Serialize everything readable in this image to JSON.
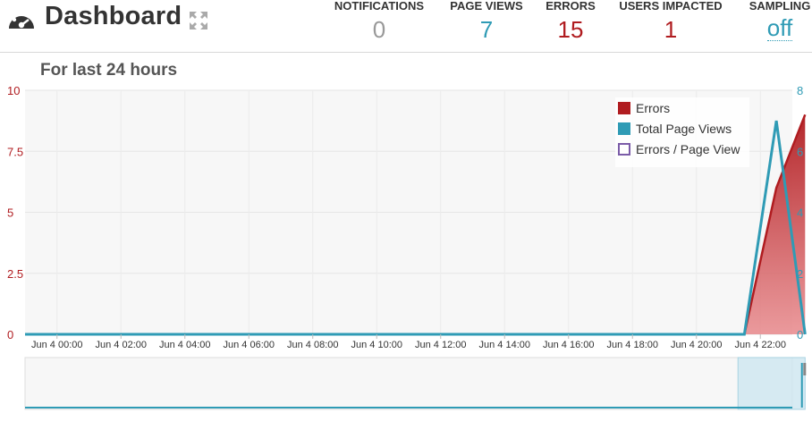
{
  "header": {
    "title": "Dashboard",
    "stats": [
      {
        "label": "NOTIFICATIONS",
        "value": "0",
        "color": "#999999"
      },
      {
        "label": "PAGE VIEWS",
        "value": "7",
        "color": "#2f9bb5"
      },
      {
        "label": "ERRORS",
        "value": "15",
        "color": "#b01c20"
      },
      {
        "label": "USERS IMPACTED",
        "value": "1",
        "color": "#b01c20"
      },
      {
        "label": "SAMPLING",
        "value": "off",
        "color": "#2f9bb5"
      }
    ]
  },
  "section": {
    "title": "For last 24 hours"
  },
  "legend": {
    "errors": "Errors",
    "page_views": "Total Page Views",
    "ratio": "Errors / Page View"
  },
  "chart_data": {
    "type": "area",
    "x_tick_labels": [
      "Jun 4 00:00",
      "Jun 4 02:00",
      "Jun 4 04:00",
      "Jun 4 06:00",
      "Jun 4 08:00",
      "Jun 4 10:00",
      "Jun 4 12:00",
      "Jun 4 14:00",
      "Jun 4 16:00",
      "Jun 4 18:00",
      "Jun 4 20:00",
      "Jun 4 22:00"
    ],
    "x_hours_range": [
      -1,
      23
    ],
    "left_axis": {
      "ticks": [
        "0",
        "2.5",
        "5",
        "7.5",
        "10"
      ],
      "range": [
        0,
        10
      ],
      "color": "#b01c20"
    },
    "right_axis": {
      "ticks": [
        "0",
        "2",
        "4",
        "6",
        "8"
      ],
      "range": [
        0,
        8
      ],
      "color": "#2f9bb5"
    },
    "series": [
      {
        "name": "Errors",
        "axis": "left",
        "kind": "area",
        "color": "#b01c20",
        "points": [
          [
            -1,
            0
          ],
          [
            21.5,
            0
          ],
          [
            22.5,
            6
          ],
          [
            23.4,
            9
          ]
        ]
      },
      {
        "name": "Total Page Views",
        "axis": "right",
        "kind": "line",
        "color": "#2f9bb5",
        "points": [
          [
            -1,
            0
          ],
          [
            21.5,
            0
          ],
          [
            22.5,
            7
          ],
          [
            23.4,
            0
          ]
        ]
      },
      {
        "name": "Errors / Page View",
        "axis": "left",
        "kind": "line",
        "color": "#7b5ca8",
        "points": []
      }
    ],
    "grid": true,
    "legend_position": "top-right"
  },
  "navigator": {
    "selected_range_hours": [
      21.3,
      23.4
    ]
  }
}
